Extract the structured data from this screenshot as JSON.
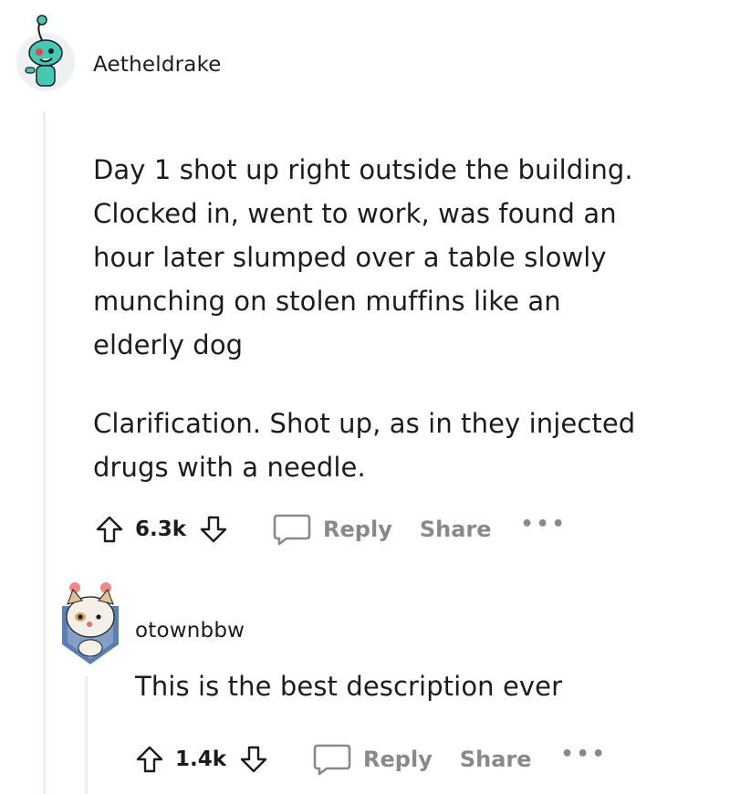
{
  "comments": [
    {
      "username": "Aetheldrake",
      "avatar": "snoo-zombie-avatar",
      "paragraphs": [
        "Day 1 shot up right outside the building.",
        "Clocked in, went to work, was found an",
        "hour later slumped over a table slowly",
        "munching on stolen muffins like an",
        "elderly dog"
      ],
      "paragraphs2": [
        "Clarification. Shot up, as in they injected",
        "drugs with a needle."
      ],
      "votes": "6.3k",
      "reply_label": "Reply",
      "share_label": "Share",
      "more_label": "•••"
    },
    {
      "username": "otownbbw",
      "avatar": "snoo-cat-avatar",
      "text": "This is the best description ever",
      "votes": "1.4k",
      "reply_label": "Reply",
      "share_label": "Share",
      "more_label": "•••"
    }
  ],
  "colors": {
    "text": "#1c1c1c",
    "meta": "#878a8c",
    "thread_line": "#edeff1",
    "avatar_teal": "#45c8b4"
  }
}
